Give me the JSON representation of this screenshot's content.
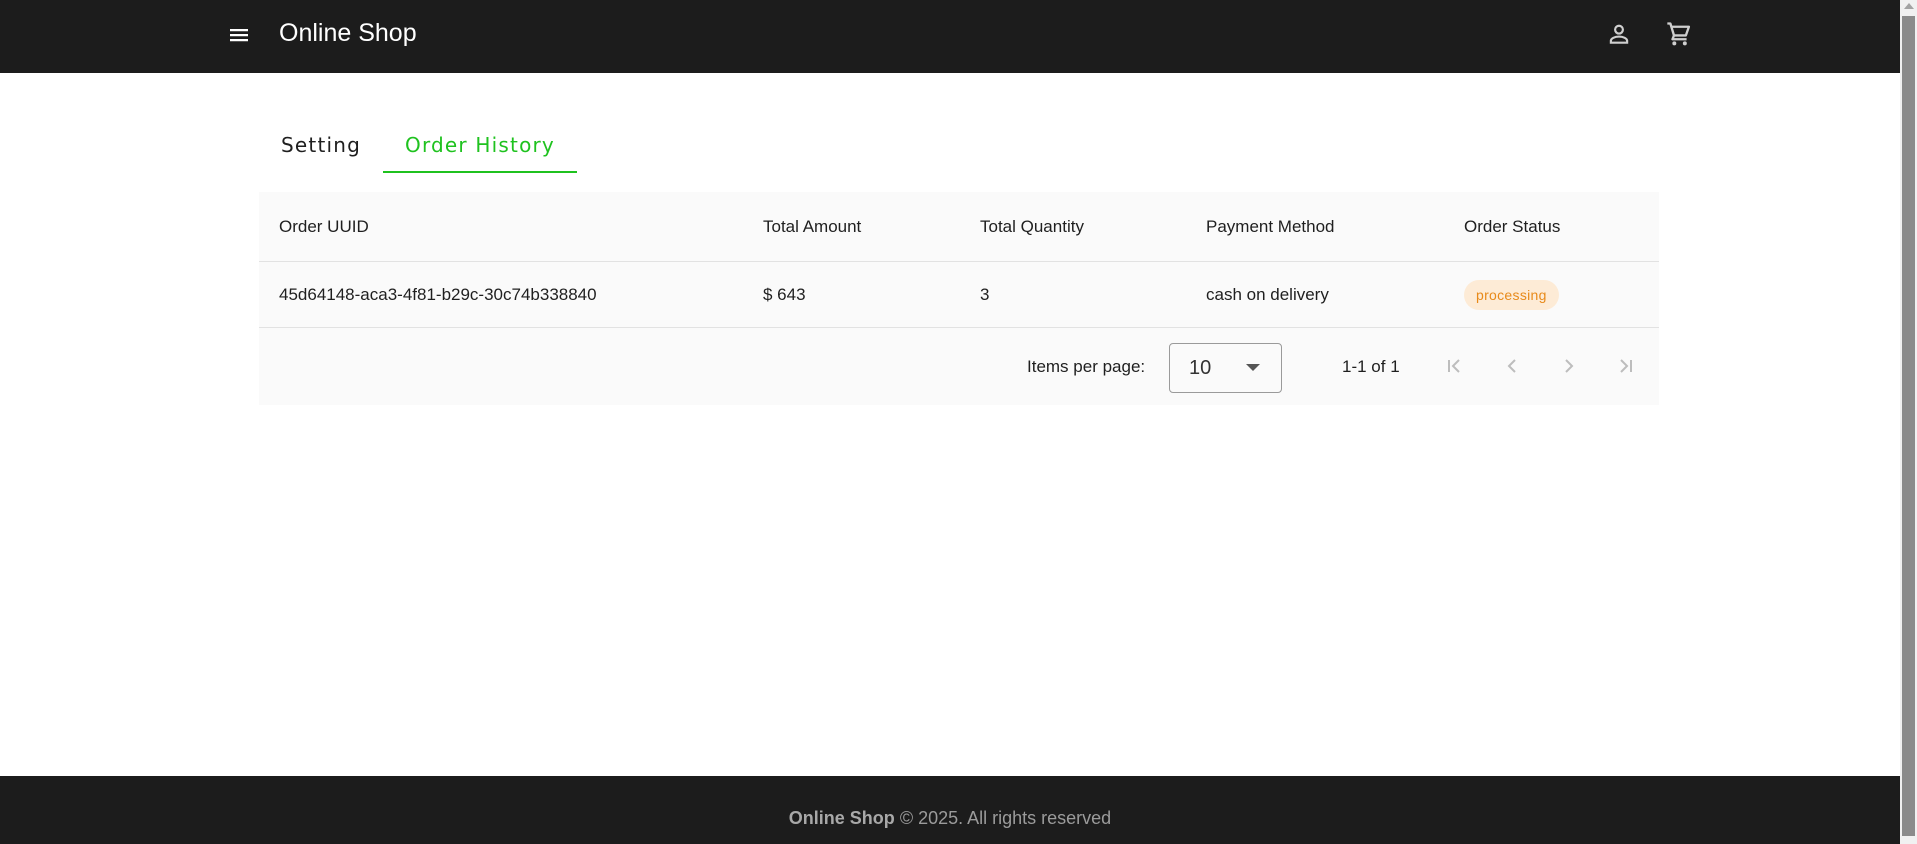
{
  "header": {
    "title": "Online Shop",
    "menu_icon": "menu-icon",
    "user_icon": "account-icon",
    "cart_icon": "shopping-cart-icon"
  },
  "tabs": [
    {
      "label": "Setting",
      "active": false
    },
    {
      "label": "Order History",
      "active": true
    }
  ],
  "table": {
    "columns": [
      "Order UUID",
      "Total Amount",
      "Total Quantity",
      "Payment Method",
      "Order Status"
    ],
    "rows": [
      {
        "uuid": "45d64148-aca3-4f81-b29c-30c74b338840",
        "amount": "$ 643",
        "quantity": "3",
        "payment": "cash on delivery",
        "status": "processing"
      }
    ]
  },
  "paginator": {
    "items_per_page_label": "Items per page:",
    "page_size": "10",
    "range_label": "1-1 of 1"
  },
  "footer": {
    "brand": "Online Shop",
    "text": "© 2025. All rights reserved"
  },
  "colors": {
    "header_bg": "#1c1c1c",
    "accent_green": "#1fc21f",
    "status_processing_bg": "#fdebd6",
    "status_processing_text": "#e88a1a"
  }
}
